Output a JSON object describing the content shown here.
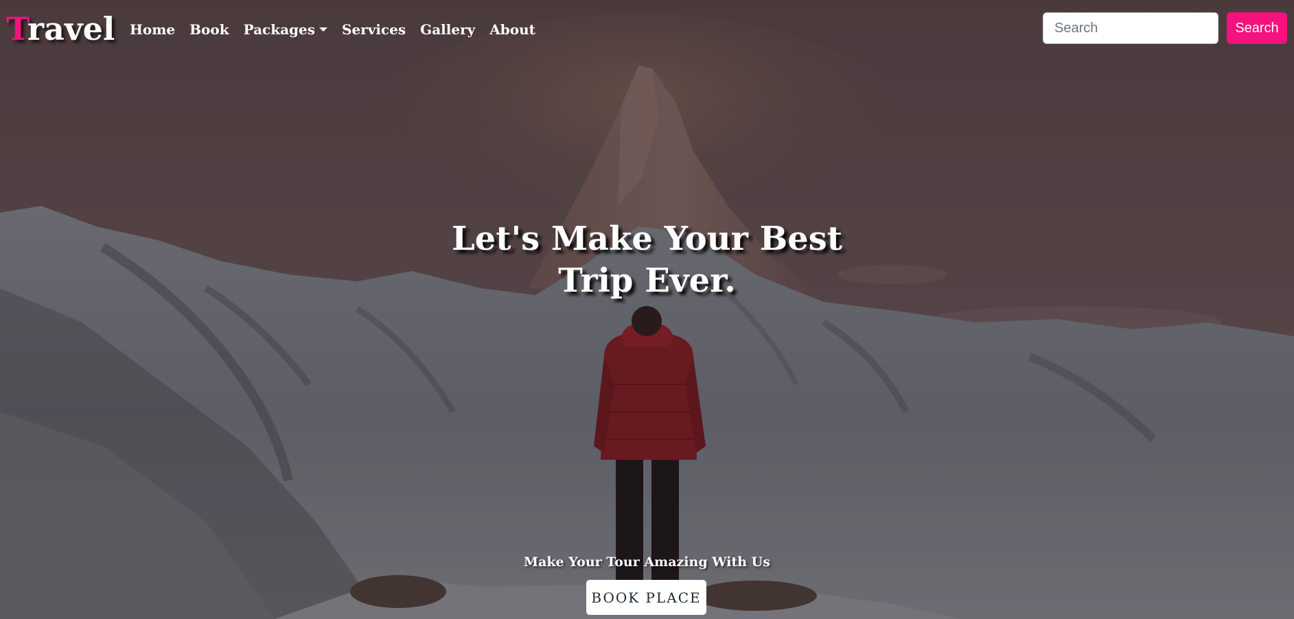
{
  "navbar": {
    "brand_first_letter": "T",
    "brand_rest": "ravel",
    "links": [
      {
        "label": "Home"
      },
      {
        "label": "Book"
      },
      {
        "label": "Packages",
        "has_dropdown": true
      },
      {
        "label": "Services"
      },
      {
        "label": "Gallery"
      },
      {
        "label": "About"
      }
    ],
    "search_placeholder": "Search",
    "search_button": "Search"
  },
  "hero": {
    "headline_line1": "Let's Make Your Best",
    "headline_line2": "Trip Ever.",
    "tagline": "Make Your Tour Amazing With Us",
    "cta_label": "BOOK PLACE"
  },
  "colors": {
    "accent": "#f5117e",
    "overlay": "#5a4848",
    "text": "#ffffff"
  },
  "icons": {
    "dropdown": "caret-down-icon"
  }
}
